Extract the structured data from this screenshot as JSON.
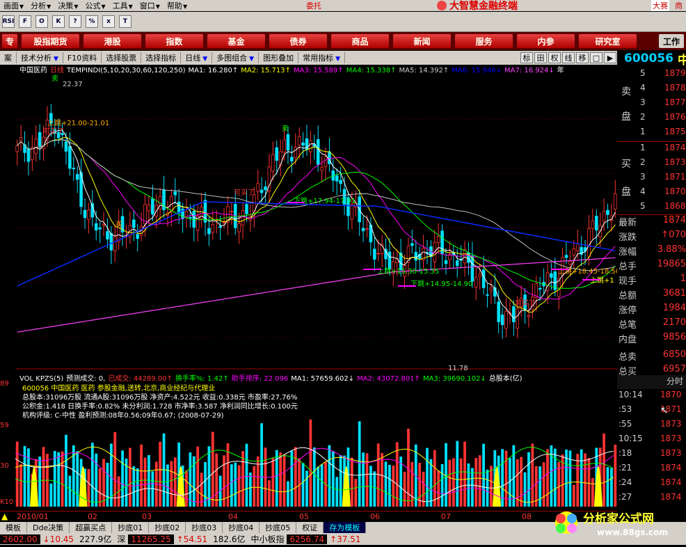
{
  "menu": [
    {
      "label": "画面",
      "arrow": true
    },
    {
      "label": "分析",
      "arrow": true
    },
    {
      "label": "决策",
      "arrow": true
    },
    {
      "label": "公式",
      "arrow": true
    },
    {
      "label": "工具",
      "arrow": true
    },
    {
      "label": "窗口",
      "arrow": true
    },
    {
      "label": "帮助",
      "arrow": true
    }
  ],
  "menu_extra": {
    "trade": "委托",
    "brand": "大智慧金融终端",
    "tag_right": "大赛",
    "tag_right2": "商"
  },
  "iconbar": [
    "RSI",
    "F",
    "O",
    "K",
    "?",
    "%",
    "x",
    "T"
  ],
  "red_tabs": [
    "股指期货",
    "港股",
    "指数",
    "基金",
    "债券",
    "商品",
    "新闻",
    "服务",
    "内参",
    "研究室"
  ],
  "red_tab_right": "工作",
  "red_tab_first": "专",
  "func_bar": [
    {
      "label": "技术分析",
      "arrow": true
    },
    {
      "label": "F10资料",
      "arrow": false
    },
    {
      "label": "选择股票",
      "arrow": false
    },
    {
      "label": "选择指标",
      "arrow": false
    },
    {
      "label": "日线",
      "arrow": true
    },
    {
      "label": "多图组合",
      "arrow": true
    },
    {
      "label": "图形叠加",
      "arrow": false
    },
    {
      "label": "常用指标",
      "arrow": true
    }
  ],
  "func_first": "案",
  "func_buttons": [
    "标",
    "田",
    "权",
    "线",
    "移",
    "□",
    "▶"
  ],
  "stock_code": "600056",
  "stock_code_suffix": "中",
  "main_header": {
    "name": "中国医药",
    "period": "日线",
    "indicator": "TEMPINDI(5,10,20,30,60,120,250)",
    "ma1": "MA1: 16.280↑",
    "ma2": "MA2: 15.713↑",
    "ma3": "MA3: 15.589↑",
    "ma4": "MA4: 15.338↑",
    "ma5": "MA5: 14.392↑",
    "ma6": "MA6: 15.946↓",
    "ma7": "MA7: 16.924↓",
    "suffix": "年"
  },
  "chart_annotations": {
    "high": "22.37",
    "low": "11.78",
    "sell1": "卖",
    "sell2": "卖",
    "buy1": "买",
    "buy_ok1": "可买了",
    "buy_ok2": "可买了",
    "buy_ok3": "可买了",
    "gap1": "上跳+21.00-21.01",
    "gap2": "下跳+17.94-17.91",
    "gap3": "上跳+15.30-15.35",
    "gap4": "下跳+14.95-14.90",
    "gap5": "上跳+18.45-18.50",
    "gap6": "上跳+1"
  },
  "vol_header": {
    "name": "VOL KPZS(5)",
    "forecast": "预测成交: 0,",
    "done": "已成交: 44289.00↑",
    "turnover": "换手率%: 1.42↑",
    "rank": "助手排序: 22.096",
    "ma1": "MA1: 57659.602↓",
    "ma2": "MA2: 43072.801↑",
    "ma3": "MA3: 39690.102↓",
    "cap": "总股本(亿)"
  },
  "info_lines": [
    "600056 中国医药 医药 参股金融,送转,北京,商业经纪与代理业",
    "总股本:31096万股 流通A股:31096万股 净资产:4.522元 收益:0.338元 市盈率:27.76%",
    "公积金:1.418 日换手率:0.82% 未分利润:1.728 市净率:3.587 净利润同比增长:0.100元",
    "机构评级: C-中性 盈利预测:08年0.56;09年0.67; (2008-07-29)"
  ],
  "left_axis": [
    "89",
    "59",
    "30",
    "K10"
  ],
  "order_book": {
    "sell_side": "卖盘",
    "buy_side": "买盘",
    "asks": [
      {
        "lvl": "5",
        "px": "1879"
      },
      {
        "lvl": "4",
        "px": "1878"
      },
      {
        "lvl": "3",
        "px": "1877"
      },
      {
        "lvl": "2",
        "px": "1876"
      },
      {
        "lvl": "1",
        "px": "1875"
      }
    ],
    "bids": [
      {
        "lvl": "1",
        "px": "1874"
      },
      {
        "lvl": "2",
        "px": "1873"
      },
      {
        "lvl": "3",
        "px": "1871"
      },
      {
        "lvl": "4",
        "px": "1870"
      },
      {
        "lvl": "5",
        "px": "1868"
      }
    ]
  },
  "stats": [
    {
      "label": "最新",
      "value": "1874"
    },
    {
      "label": "涨跌",
      "value": "↑070"
    },
    {
      "label": "涨幅",
      "value": "3.88%"
    },
    {
      "label": "总手",
      "value": "19865"
    },
    {
      "label": "现手",
      "value": "1"
    },
    {
      "label": "总额",
      "value": "3681"
    },
    {
      "label": "涨停",
      "value": "1984"
    },
    {
      "label": "总笔",
      "value": "2170"
    },
    {
      "label": "内盘",
      "value": "9856"
    },
    {
      "label": "总卖",
      "value": "6850"
    },
    {
      "label": "总买",
      "value": "6957"
    }
  ],
  "tick_header": "分时",
  "ticks": [
    {
      "t": "10:14",
      "p": "1870"
    },
    {
      "t": ":53",
      "p": "1871"
    },
    {
      "t": ":55",
      "p": "1873"
    },
    {
      "t": "10:15",
      "p": "1873"
    },
    {
      "t": ":18",
      "p": "1873"
    },
    {
      "t": ":21",
      "p": "1874"
    },
    {
      "t": ":24",
      "p": "1874"
    },
    {
      "t": ":27",
      "p": "1874"
    }
  ],
  "timeline": [
    "2010/01",
    "02",
    "03",
    "04",
    "05",
    "06",
    "07",
    "08"
  ],
  "bottom_tabs": [
    "模板",
    "Dde决策",
    "超赢买点",
    "抄底01",
    "抄底02",
    "抄底03",
    "抄底04",
    "抄底05",
    "权证",
    "存为模板"
  ],
  "status_bar": [
    {
      "v": "2602.00",
      "c": "blk"
    },
    {
      "v": "↓10.45",
      "c": "red"
    },
    {
      "v": "227.9亿",
      "c": ""
    },
    {
      "v": "深",
      "c": ""
    },
    {
      "v": "11265.25",
      "c": "blk"
    },
    {
      "v": "↑54.51",
      "c": "up"
    },
    {
      "v": "182.6亿",
      "c": ""
    },
    {
      "v": "中小板指",
      "c": ""
    },
    {
      "v": "6256.74",
      "c": "blk"
    },
    {
      "v": "↑37.51",
      "c": "up"
    }
  ],
  "watermark": {
    "title": "分析家公式网",
    "url": "www.88gs.com"
  },
  "colors": {
    "up": "#ff3333",
    "down": "#00e0ff",
    "ma1": "#ffffff",
    "ma2": "#ffff00",
    "ma3": "#ff00ff",
    "ma4": "#00ff00",
    "ma5": "#c0c0c0",
    "ma6": "#0000ff",
    "ma7": "#ff40ff"
  }
}
